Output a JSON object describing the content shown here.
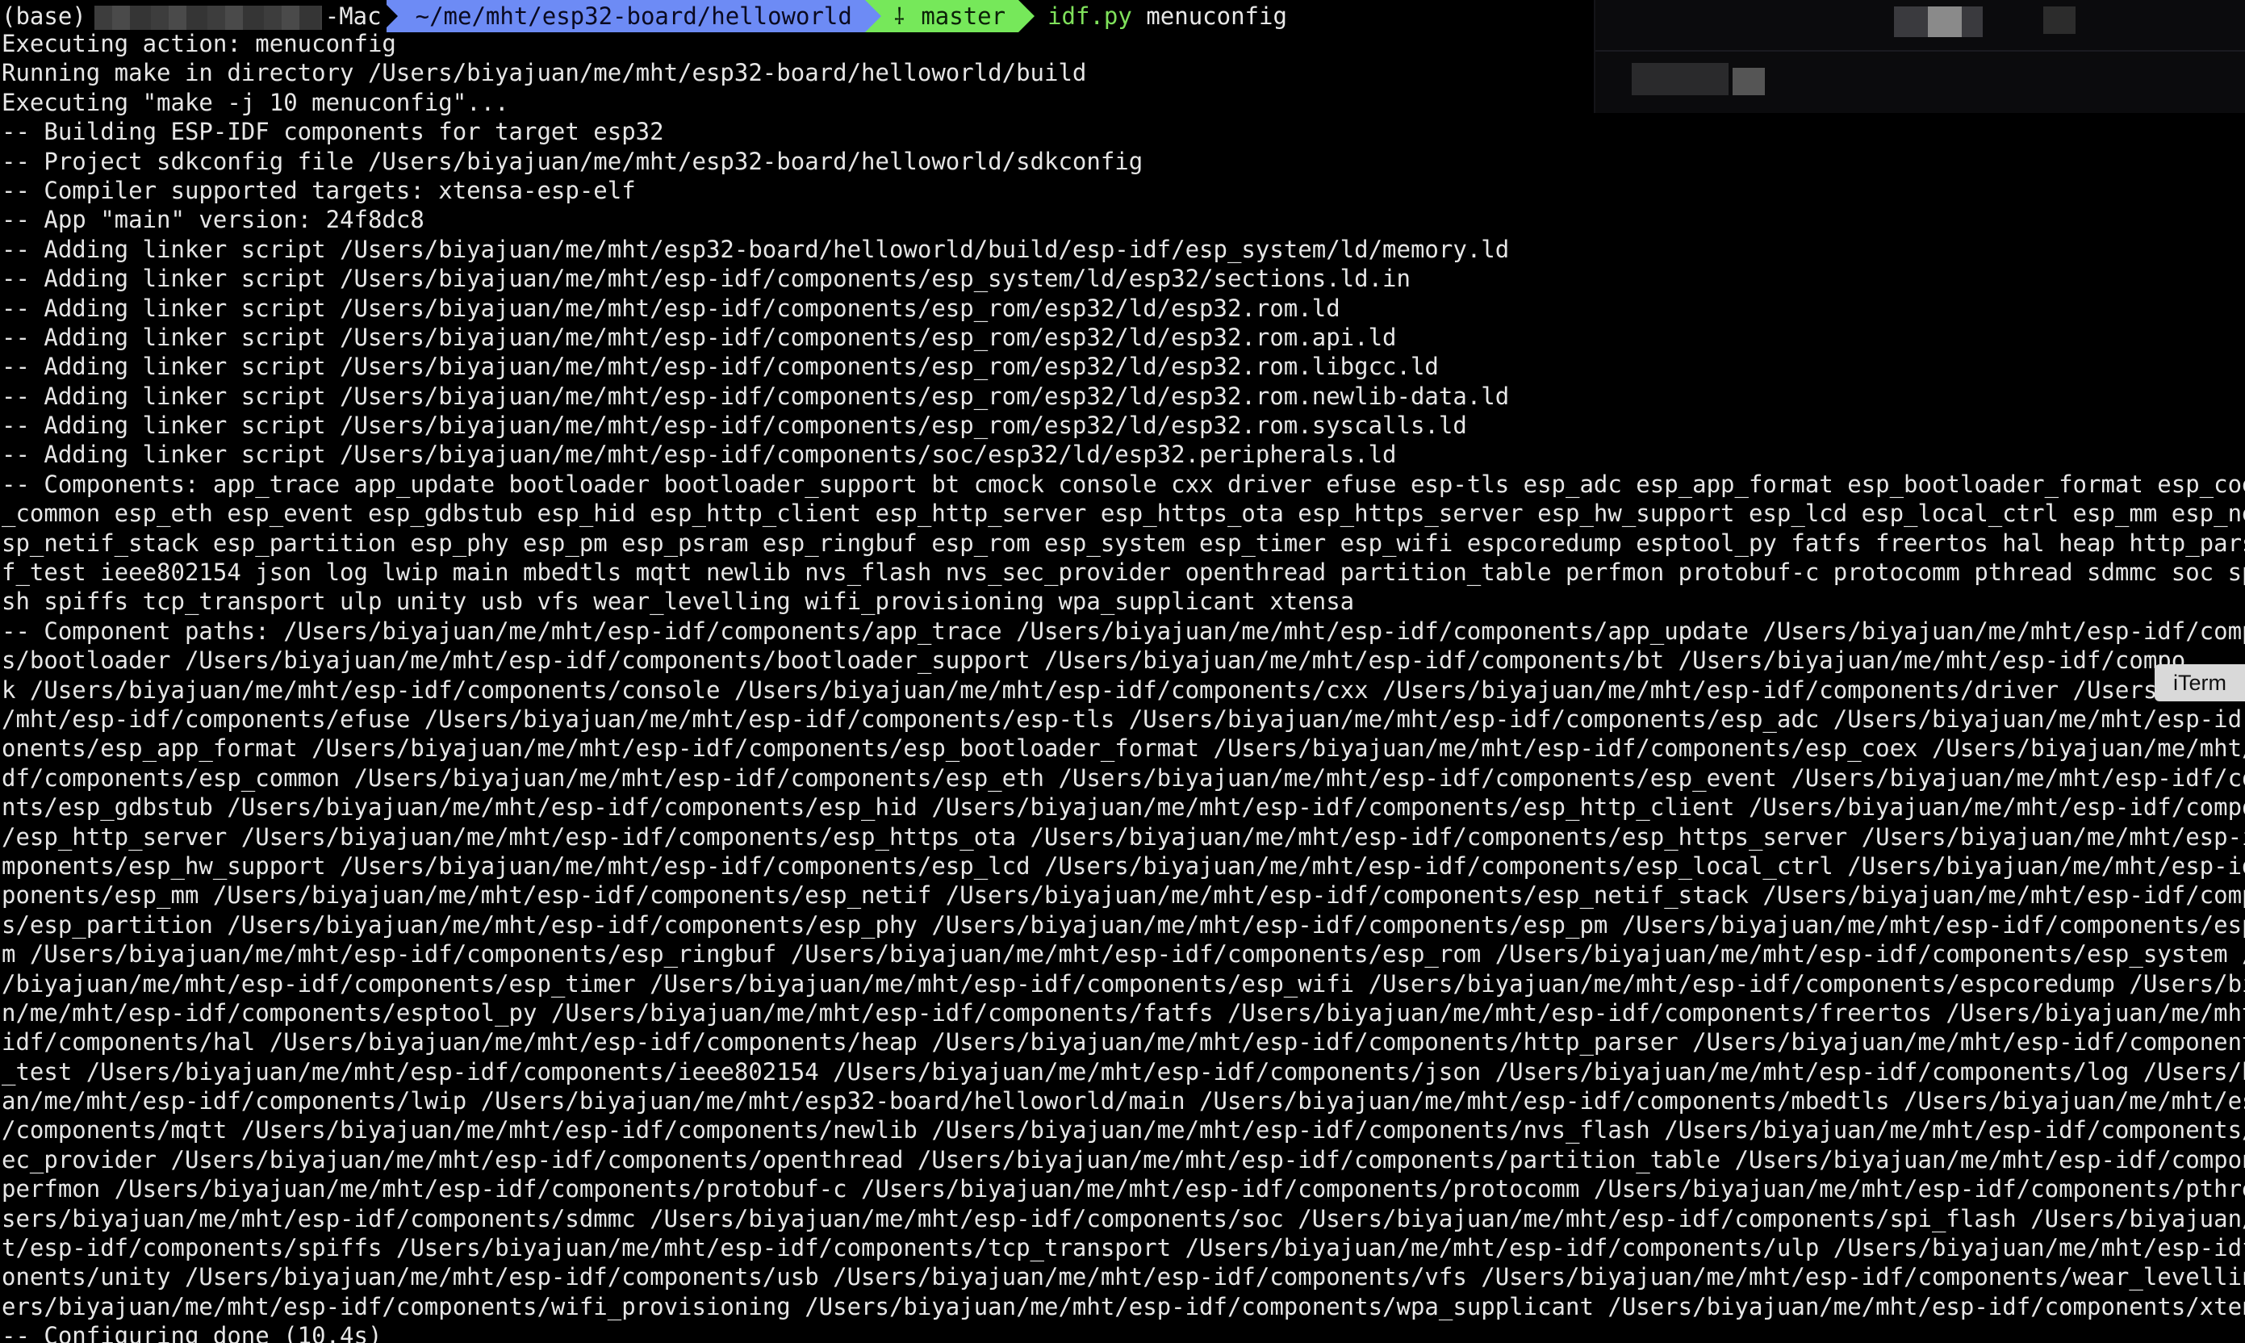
{
  "prompt": {
    "env": "(base)",
    "host_suffix": "-Mac",
    "path": "~/me/mht/esp32-board/helloworld",
    "branch_icon": "git-branch-icon",
    "branch": "master",
    "command": "idf.py",
    "command_arg": "menuconfig"
  },
  "overlay": {
    "app_label": "iTerm"
  },
  "colors": {
    "path_bg": "#6d8bf5",
    "branch_bg": "#76e85a",
    "command": "#7fe15b",
    "text": "#e6e6e6",
    "background": "#000000"
  },
  "output_lines": [
    "Executing action: menuconfig",
    "Running make in directory /Users/biyajuan/me/mht/esp32-board/helloworld/build",
    "Executing \"make -j 10 menuconfig\"...",
    "-- Building ESP-IDF components for target esp32",
    "-- Project sdkconfig file /Users/biyajuan/me/mht/esp32-board/helloworld/sdkconfig",
    "-- Compiler supported targets: xtensa-esp-elf",
    "-- App \"main\" version: 24f8dc8",
    "-- Adding linker script /Users/biyajuan/me/mht/esp32-board/helloworld/build/esp-idf/esp_system/ld/memory.ld",
    "-- Adding linker script /Users/biyajuan/me/mht/esp-idf/components/esp_system/ld/esp32/sections.ld.in",
    "-- Adding linker script /Users/biyajuan/me/mht/esp-idf/components/esp_rom/esp32/ld/esp32.rom.ld",
    "-- Adding linker script /Users/biyajuan/me/mht/esp-idf/components/esp_rom/esp32/ld/esp32.rom.api.ld",
    "-- Adding linker script /Users/biyajuan/me/mht/esp-idf/components/esp_rom/esp32/ld/esp32.rom.libgcc.ld",
    "-- Adding linker script /Users/biyajuan/me/mht/esp-idf/components/esp_rom/esp32/ld/esp32.rom.newlib-data.ld",
    "-- Adding linker script /Users/biyajuan/me/mht/esp-idf/components/esp_rom/esp32/ld/esp32.rom.syscalls.ld",
    "-- Adding linker script /Users/biyajuan/me/mht/esp-idf/components/soc/esp32/ld/esp32.peripherals.ld",
    "-- Components: app_trace app_update bootloader bootloader_support bt cmock console cxx driver efuse esp-tls esp_adc esp_app_format esp_bootloader_format esp_coex",
    "_common esp_eth esp_event esp_gdbstub esp_hid esp_http_client esp_http_server esp_https_ota esp_https_server esp_hw_support esp_lcd esp_local_ctrl esp_mm esp_net",
    "sp_netif_stack esp_partition esp_phy esp_pm esp_psram esp_ringbuf esp_rom esp_system esp_timer esp_wifi espcoredump esptool_py fatfs freertos hal heap http_parse",
    "f_test ieee802154 json log lwip main mbedtls mqtt newlib nvs_flash nvs_sec_provider openthread partition_table perfmon protobuf-c protocomm pthread sdmmc soc spi",
    "sh spiffs tcp_transport ulp unity usb vfs wear_levelling wifi_provisioning wpa_supplicant xtensa",
    "-- Component paths: /Users/biyajuan/me/mht/esp-idf/components/app_trace /Users/biyajuan/me/mht/esp-idf/components/app_update /Users/biyajuan/me/mht/esp-idf/compo",
    "s/bootloader /Users/biyajuan/me/mht/esp-idf/components/bootloader_support /Users/biyajuan/me/mht/esp-idf/components/bt /Users/biyajuan/me/mht/esp-idf/compo",
    "k /Users/biyajuan/me/mht/esp-idf/components/console /Users/biyajuan/me/mht/esp-idf/components/cxx /Users/biyajuan/me/mht/esp-idf/components/driver /Users/",
    "/mht/esp-idf/components/efuse /Users/biyajuan/me/mht/esp-idf/components/esp-tls /Users/biyajuan/me/mht/esp-idf/components/esp_adc /Users/biyajuan/me/mht/esp-id",
    "onents/esp_app_format /Users/biyajuan/me/mht/esp-idf/components/esp_bootloader_format /Users/biyajuan/me/mht/esp-idf/components/esp_coex /Users/biyajuan/me/mht/e",
    "df/components/esp_common /Users/biyajuan/me/mht/esp-idf/components/esp_eth /Users/biyajuan/me/mht/esp-idf/components/esp_event /Users/biyajuan/me/mht/esp-idf/com",
    "nts/esp_gdbstub /Users/biyajuan/me/mht/esp-idf/components/esp_hid /Users/biyajuan/me/mht/esp-idf/components/esp_http_client /Users/biyajuan/me/mht/esp-idf/compor",
    "/esp_http_server /Users/biyajuan/me/mht/esp-idf/components/esp_https_ota /Users/biyajuan/me/mht/esp-idf/components/esp_https_server /Users/biyajuan/me/mht/esp-ic",
    "mponents/esp_hw_support /Users/biyajuan/me/mht/esp-idf/components/esp_lcd /Users/biyajuan/me/mht/esp-idf/components/esp_local_ctrl /Users/biyajuan/me/mht/esp-idf",
    "ponents/esp_mm /Users/biyajuan/me/mht/esp-idf/components/esp_netif /Users/biyajuan/me/mht/esp-idf/components/esp_netif_stack /Users/biyajuan/me/mht/esp-idf/compo",
    "s/esp_partition /Users/biyajuan/me/mht/esp-idf/components/esp_phy /Users/biyajuan/me/mht/esp-idf/components/esp_pm /Users/biyajuan/me/mht/esp-idf/components/esp_",
    "m /Users/biyajuan/me/mht/esp-idf/components/esp_ringbuf /Users/biyajuan/me/mht/esp-idf/components/esp_rom /Users/biyajuan/me/mht/esp-idf/components/esp_system /U",
    "/biyajuan/me/mht/esp-idf/components/esp_timer /Users/biyajuan/me/mht/esp-idf/components/esp_wifi /Users/biyajuan/me/mht/esp-idf/components/espcoredump /Users/biy",
    "n/me/mht/esp-idf/components/esptool_py /Users/biyajuan/me/mht/esp-idf/components/fatfs /Users/biyajuan/me/mht/esp-idf/components/freertos /Users/biyajuan/me/mht/",
    "idf/components/hal /Users/biyajuan/me/mht/esp-idf/components/heap /Users/biyajuan/me/mht/esp-idf/components/http_parser /Users/biyajuan/me/mht/esp-idf/components",
    "_test /Users/biyajuan/me/mht/esp-idf/components/ieee802154 /Users/biyajuan/me/mht/esp-idf/components/json /Users/biyajuan/me/mht/esp-idf/components/log /Users/bi",
    "an/me/mht/esp-idf/components/lwip /Users/biyajuan/me/mht/esp32-board/helloworld/main /Users/biyajuan/me/mht/esp-idf/components/mbedtls /Users/biyajuan/me/mht/esp",
    "/components/mqtt /Users/biyajuan/me/mht/esp-idf/components/newlib /Users/biyajuan/me/mht/esp-idf/components/nvs_flash /Users/biyajuan/me/mht/esp-idf/components/r",
    "ec_provider /Users/biyajuan/me/mht/esp-idf/components/openthread /Users/biyajuan/me/mht/esp-idf/components/partition_table /Users/biyajuan/me/mht/esp-idf/compone",
    "perfmon /Users/biyajuan/me/mht/esp-idf/components/protobuf-c /Users/biyajuan/me/mht/esp-idf/components/protocomm /Users/biyajuan/me/mht/esp-idf/components/pthre",
    "sers/biyajuan/me/mht/esp-idf/components/sdmmc /Users/biyajuan/me/mht/esp-idf/components/soc /Users/biyajuan/me/mht/esp-idf/components/spi_flash /Users/biyajuan/",
    "t/esp-idf/components/spiffs /Users/biyajuan/me/mht/esp-idf/components/tcp_transport /Users/biyajuan/me/mht/esp-idf/components/ulp /Users/biyajuan/me/mht/esp-idf/",
    "onents/unity /Users/biyajuan/me/mht/esp-idf/components/usb /Users/biyajuan/me/mht/esp-idf/components/vfs /Users/biyajuan/me/mht/esp-idf/components/wear_levelling",
    "ers/biyajuan/me/mht/esp-idf/components/wifi_provisioning /Users/biyajuan/me/mht/esp-idf/components/wpa_supplicant /Users/biyajuan/me/mht/esp-idf/components/xtens",
    "-- Configuring done (10.4s)"
  ]
}
